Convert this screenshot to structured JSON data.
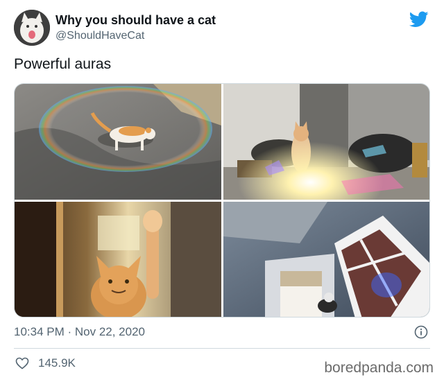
{
  "tweet": {
    "display_name": "Why you should have a cat",
    "handle": "@ShouldHaveCat",
    "text": "Powerful auras",
    "timestamp": "10:34 PM · Nov 22, 2020",
    "likes": "145.9K"
  },
  "media": {
    "photos": [
      "cat-in-rainbow-bubble",
      "cat-in-sunlight-prism",
      "cat-reaching-paw-sunlight",
      "cat-under-window-light"
    ]
  },
  "watermark": "boredpanda.com",
  "colors": {
    "twitter_blue": "#1d9bf0",
    "secondary_text": "#536471",
    "divider": "#cfd9de"
  },
  "icons": {
    "brand": "twitter-bird-icon",
    "info": "info-icon",
    "like": "heart-icon"
  }
}
